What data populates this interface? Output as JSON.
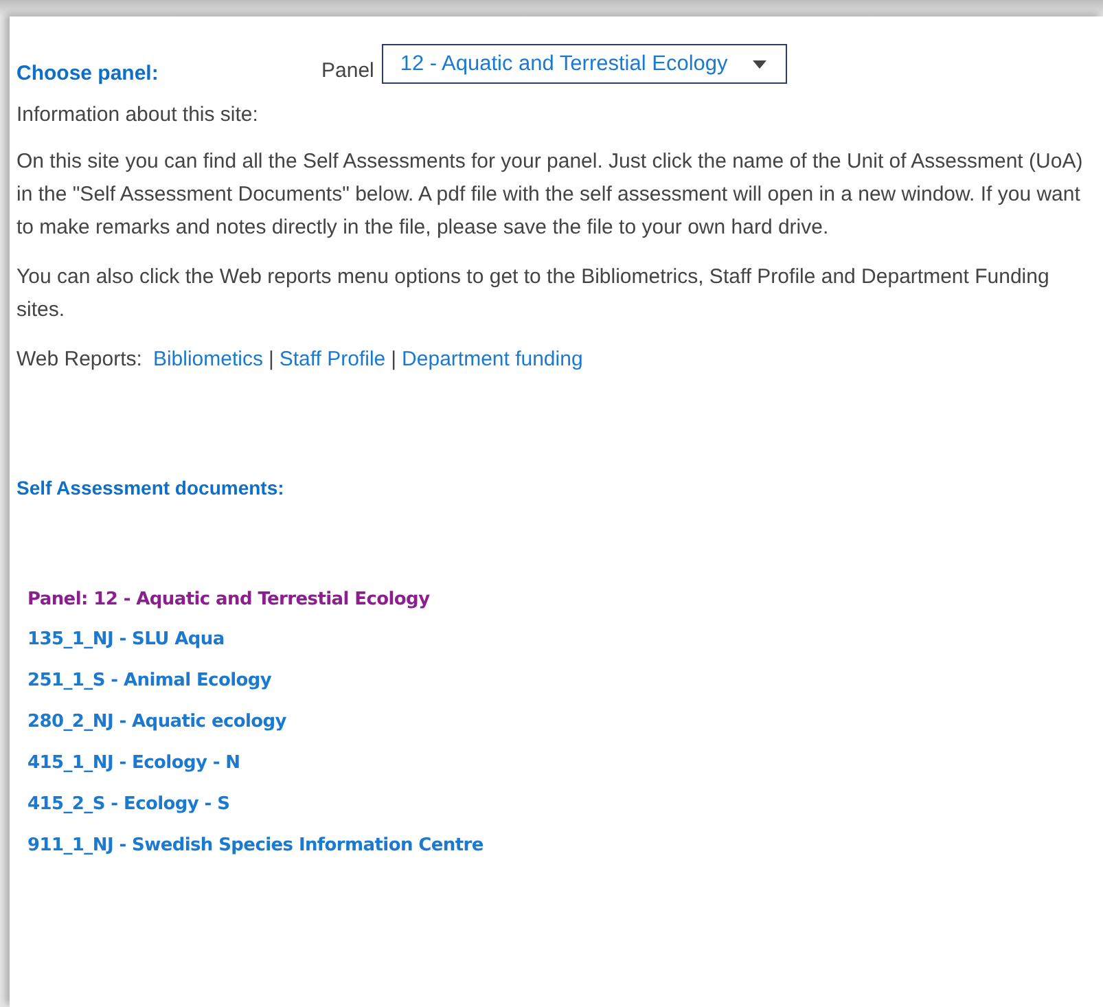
{
  "choose_panel": {
    "heading": "Choose panel:",
    "label": "Panel",
    "value": "12 - Aquatic and Terrestial Ecology"
  },
  "info": {
    "title": "Information about this site:",
    "paragraphs": [
      "On this site you can find all the Self Assessments for your panel. Just click the name of the Unit of Assessment (UoA) in the \"Self Assessment Documents\" below. A pdf file with the self assessment will open in a new window. If you want to make remarks and notes directly in the file, please save the file to your own hard drive.",
      "You can also click the Web reports menu options to get to the Bibliometrics, Staff Profile and Department Funding sites."
    ]
  },
  "web_reports": {
    "label": "Web Reports:",
    "items": [
      {
        "kind": "link",
        "text": "Bibliometics"
      },
      {
        "kind": "separator",
        "text": "|"
      },
      {
        "kind": "link",
        "text": "Staff Profile"
      },
      {
        "kind": "separator",
        "text": "|"
      },
      {
        "kind": "link",
        "text": "Department funding"
      }
    ]
  },
  "documents": {
    "heading": "Self Assessment documents:",
    "panel_title": "Panel: 12 - Aquatic and Terrestial Ecology",
    "items": [
      "135_1_NJ - SLU Aqua",
      "251_1_S - Animal Ecology",
      "280_2_NJ - Aquatic ecology",
      "415_1_NJ - Ecology - N",
      "415_2_S - Ecology - S",
      "911_1_NJ - Swedish Species Information Centre"
    ]
  }
}
